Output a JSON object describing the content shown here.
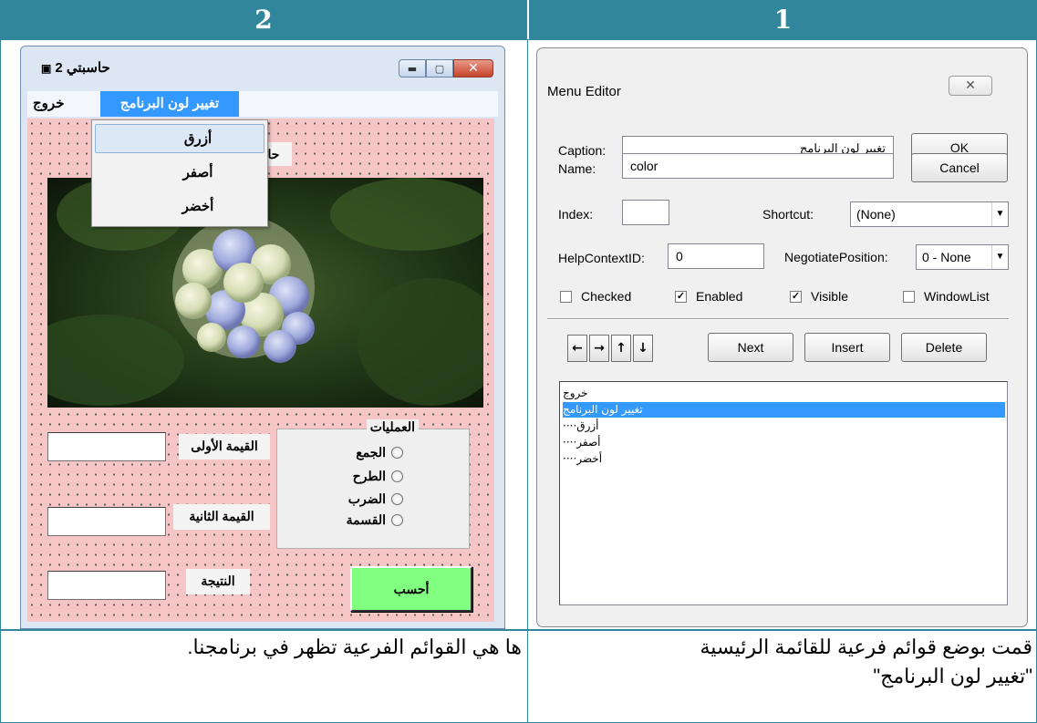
{
  "headers": {
    "left": "2",
    "right": "1"
  },
  "calculator": {
    "title": "حاسبتي 2",
    "menu": {
      "exit": "خروج",
      "change_color": "تغيير لون البرنامج"
    },
    "submenu": [
      "أزرق",
      "أصفر",
      "أخضر"
    ],
    "hidden_label": "حا",
    "first_value_label": "القيمة الأولى",
    "second_value_label": "القيمة الثانية",
    "result_label": "النتيجة",
    "operations_title": "العمليات",
    "operations": [
      "الجمع",
      "الطرح",
      "الضرب",
      "القسمة"
    ],
    "calc_button": "أحسب"
  },
  "menu_editor": {
    "title": "Menu Editor",
    "close_icon": "✕",
    "caption_label": "Caption:",
    "caption_value": "تغيير لون البرنامج",
    "name_label": "Name:",
    "name_value": "color",
    "index_label": "Index:",
    "index_value": "",
    "shortcut_label": "Shortcut:",
    "shortcut_value": "(None)",
    "helpcontext_label": "HelpContextID:",
    "helpcontext_value": "0",
    "negotiate_label": "NegotiatePosition:",
    "negotiate_value": "0 - None",
    "ok": "OK",
    "cancel": "Cancel",
    "checked": {
      "label": "Checked",
      "value": false
    },
    "enabled": {
      "label": "Enabled",
      "value": true
    },
    "visible": {
      "label": "Visible",
      "value": true
    },
    "windowlist": {
      "label": "WindowList",
      "value": false
    },
    "arrows": [
      "←",
      "→",
      "↑",
      "↓"
    ],
    "next": "Next",
    "insert": "Insert",
    "delete": "Delete",
    "list_items": [
      "خروج",
      "تغيير لون البرنامج",
      "····أزرق",
      "····أصفر",
      "····أخضر"
    ],
    "selected_index": 1
  },
  "captions": {
    "left": "ها هي القوائم الفرعية تظهر في برنامجنا.",
    "right_line1": "قمت بوضع قوائم فرعية للقائمة الرئيسية",
    "right_line2": "\"تغيير لون البرنامج\""
  }
}
